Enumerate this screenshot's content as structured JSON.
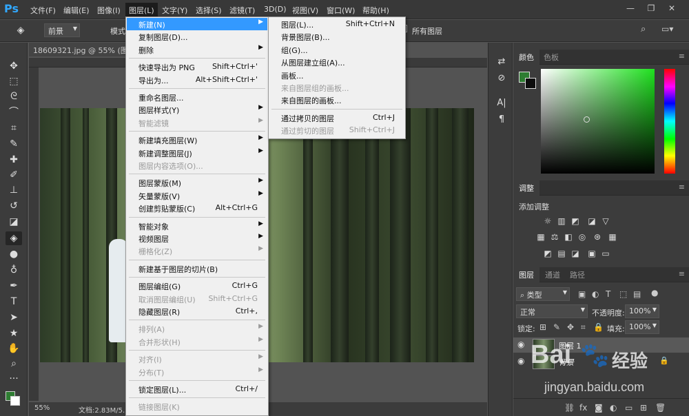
{
  "app": {
    "logo": "Ps"
  },
  "menubar": {
    "items": [
      "文件(F)",
      "编辑(E)",
      "图像(I)",
      "图层(L)",
      "文字(Y)",
      "选择(S)",
      "滤镜(T)",
      "3D(D)",
      "视图(V)",
      "窗口(W)",
      "帮助(H)"
    ],
    "active_index": 3
  },
  "window_controls": {
    "minimize": "—",
    "restore": "❐",
    "close": "✕"
  },
  "options_bar": {
    "fill_source": "前景",
    "mode_label": "模式",
    "all_layers": "所有图层"
  },
  "document": {
    "tab_title": "18609321.jpg @ 55% (图层",
    "zoom": "55%",
    "doc_info": "文档:2.83M/5."
  },
  "layer_menu": {
    "items": [
      {
        "label": "新建(N)",
        "shortcut": "",
        "submenu": true,
        "disabled": false,
        "highlighted": true
      },
      {
        "label": "复制图层(D)...",
        "shortcut": "",
        "submenu": false,
        "disabled": false
      },
      {
        "label": "删除",
        "shortcut": "",
        "submenu": true,
        "disabled": false
      },
      {
        "sep": true
      },
      {
        "label": "快速导出为 PNG",
        "shortcut": "Shift+Ctrl+'",
        "submenu": false,
        "disabled": false
      },
      {
        "label": "导出为...",
        "shortcut": "Alt+Shift+Ctrl+'",
        "submenu": false,
        "disabled": false
      },
      {
        "sep": true
      },
      {
        "label": "重命名图层...",
        "shortcut": "",
        "submenu": false,
        "disabled": false
      },
      {
        "label": "图层样式(Y)",
        "shortcut": "",
        "submenu": true,
        "disabled": false
      },
      {
        "label": "智能滤镜",
        "shortcut": "",
        "submenu": true,
        "disabled": true
      },
      {
        "sep": true
      },
      {
        "label": "新建填充图层(W)",
        "shortcut": "",
        "submenu": true,
        "disabled": false
      },
      {
        "label": "新建调整图层(J)",
        "shortcut": "",
        "submenu": true,
        "disabled": false
      },
      {
        "label": "图层内容选项(O)...",
        "shortcut": "",
        "submenu": false,
        "disabled": true
      },
      {
        "sep": true
      },
      {
        "label": "图层蒙版(M)",
        "shortcut": "",
        "submenu": true,
        "disabled": false
      },
      {
        "label": "矢量蒙版(V)",
        "shortcut": "",
        "submenu": true,
        "disabled": false
      },
      {
        "label": "创建剪贴蒙版(C)",
        "shortcut": "Alt+Ctrl+G",
        "submenu": false,
        "disabled": false
      },
      {
        "sep": true
      },
      {
        "label": "智能对象",
        "shortcut": "",
        "submenu": true,
        "disabled": false
      },
      {
        "label": "视频图层",
        "shortcut": "",
        "submenu": true,
        "disabled": false
      },
      {
        "label": "栅格化(Z)",
        "shortcut": "",
        "submenu": true,
        "disabled": true
      },
      {
        "sep": true
      },
      {
        "label": "新建基于图层的切片(B)",
        "shortcut": "",
        "submenu": false,
        "disabled": false
      },
      {
        "sep": true
      },
      {
        "label": "图层编组(G)",
        "shortcut": "Ctrl+G",
        "submenu": false,
        "disabled": false
      },
      {
        "label": "取消图层编组(U)",
        "shortcut": "Shift+Ctrl+G",
        "submenu": false,
        "disabled": true
      },
      {
        "label": "隐藏图层(R)",
        "shortcut": "Ctrl+,",
        "submenu": false,
        "disabled": false
      },
      {
        "sep": true
      },
      {
        "label": "排列(A)",
        "shortcut": "",
        "submenu": true,
        "disabled": true
      },
      {
        "label": "合并形状(H)",
        "shortcut": "",
        "submenu": true,
        "disabled": true
      },
      {
        "sep": true
      },
      {
        "label": "对齐(I)",
        "shortcut": "",
        "submenu": true,
        "disabled": true
      },
      {
        "label": "分布(T)",
        "shortcut": "",
        "submenu": true,
        "disabled": true
      },
      {
        "sep": true
      },
      {
        "label": "锁定图层(L)...",
        "shortcut": "Ctrl+/",
        "submenu": false,
        "disabled": false
      },
      {
        "sep": true
      },
      {
        "label": "链接图层(K)",
        "shortcut": "",
        "submenu": false,
        "disabled": true
      }
    ]
  },
  "new_submenu": {
    "items": [
      {
        "label": "图层(L)...",
        "shortcut": "Shift+Ctrl+N",
        "disabled": false
      },
      {
        "label": "背景图层(B)...",
        "shortcut": "",
        "disabled": false
      },
      {
        "label": "组(G)...",
        "shortcut": "",
        "disabled": false
      },
      {
        "label": "从图层建立组(A)...",
        "shortcut": "",
        "disabled": false
      },
      {
        "label": "画板...",
        "shortcut": "",
        "disabled": false
      },
      {
        "label": "来自图层组的画板...",
        "shortcut": "",
        "disabled": true
      },
      {
        "label": "来自图层的画板...",
        "shortcut": "",
        "disabled": false
      },
      {
        "sep": true
      },
      {
        "label": "通过拷贝的图层",
        "shortcut": "Ctrl+J",
        "disabled": false
      },
      {
        "label": "通过剪切的图层",
        "shortcut": "Shift+Ctrl+J",
        "disabled": true
      }
    ]
  },
  "color_panel": {
    "tabs": [
      "颜色",
      "色板"
    ],
    "foreground": "#2e7d32",
    "background": "#0d0d0d",
    "hue_color": "#1fe11f"
  },
  "adjust_panel": {
    "tab": "调整",
    "title": "添加调整"
  },
  "layers_panel": {
    "tabs": [
      "图层",
      "通道",
      "路径"
    ],
    "filter": "类型",
    "blend_mode": "正常",
    "opacity_label": "不透明度:",
    "opacity": "100%",
    "lock_label": "锁定:",
    "fill_label": "填充:",
    "fill": "100%",
    "layers": [
      {
        "name": "图层 1",
        "selected": true,
        "locked": false
      },
      {
        "name": "背景",
        "selected": false,
        "locked": true
      }
    ]
  },
  "watermark": {
    "brand": "Bai",
    "brand2": "经验",
    "url": "jingyan.baidu.com"
  }
}
